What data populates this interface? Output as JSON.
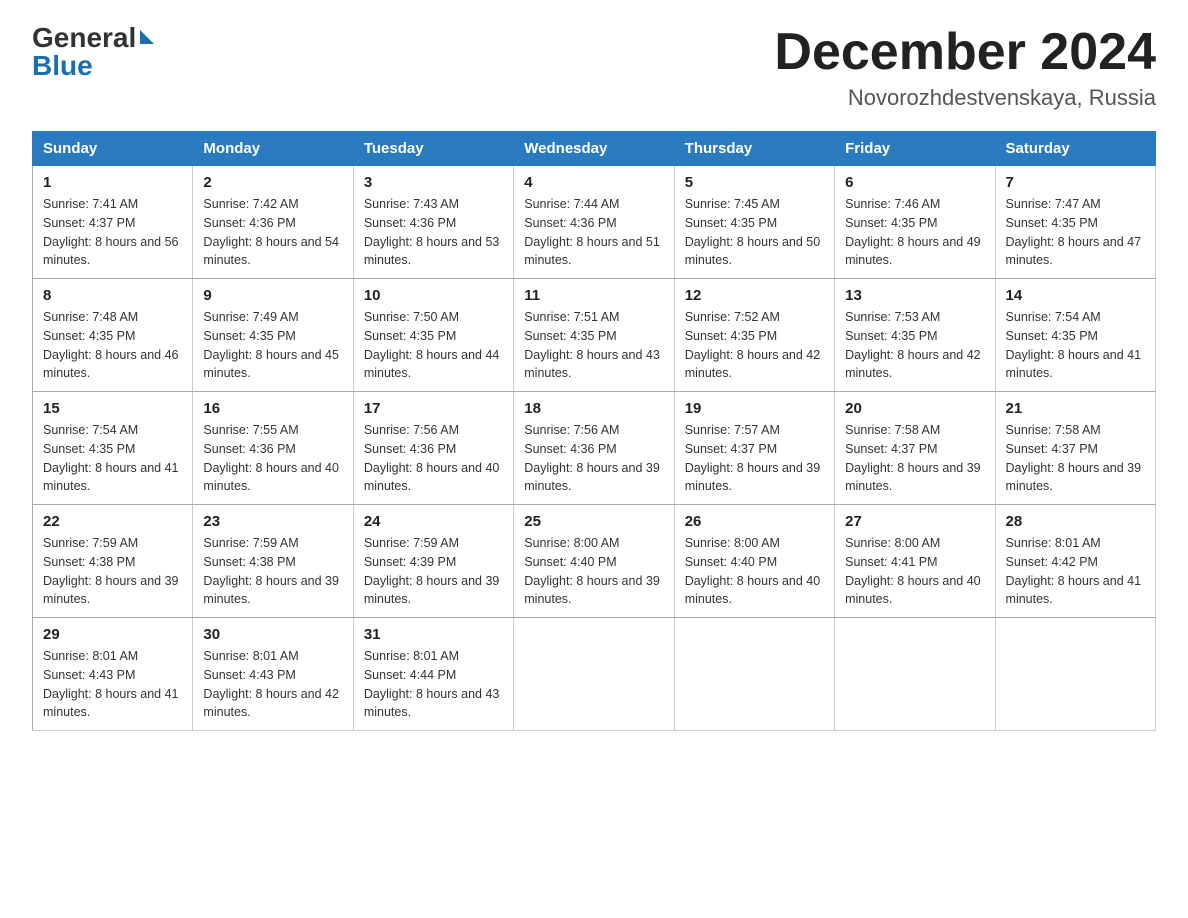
{
  "logo": {
    "general": "General",
    "blue": "Blue"
  },
  "title": "December 2024",
  "location": "Novorozhdestvenskaya, Russia",
  "days_of_week": [
    "Sunday",
    "Monday",
    "Tuesday",
    "Wednesday",
    "Thursday",
    "Friday",
    "Saturday"
  ],
  "weeks": [
    [
      {
        "day": "1",
        "sunrise": "7:41 AM",
        "sunset": "4:37 PM",
        "daylight": "8 hours and 56 minutes."
      },
      {
        "day": "2",
        "sunrise": "7:42 AM",
        "sunset": "4:36 PM",
        "daylight": "8 hours and 54 minutes."
      },
      {
        "day": "3",
        "sunrise": "7:43 AM",
        "sunset": "4:36 PM",
        "daylight": "8 hours and 53 minutes."
      },
      {
        "day": "4",
        "sunrise": "7:44 AM",
        "sunset": "4:36 PM",
        "daylight": "8 hours and 51 minutes."
      },
      {
        "day": "5",
        "sunrise": "7:45 AM",
        "sunset": "4:35 PM",
        "daylight": "8 hours and 50 minutes."
      },
      {
        "day": "6",
        "sunrise": "7:46 AM",
        "sunset": "4:35 PM",
        "daylight": "8 hours and 49 minutes."
      },
      {
        "day": "7",
        "sunrise": "7:47 AM",
        "sunset": "4:35 PM",
        "daylight": "8 hours and 47 minutes."
      }
    ],
    [
      {
        "day": "8",
        "sunrise": "7:48 AM",
        "sunset": "4:35 PM",
        "daylight": "8 hours and 46 minutes."
      },
      {
        "day": "9",
        "sunrise": "7:49 AM",
        "sunset": "4:35 PM",
        "daylight": "8 hours and 45 minutes."
      },
      {
        "day": "10",
        "sunrise": "7:50 AM",
        "sunset": "4:35 PM",
        "daylight": "8 hours and 44 minutes."
      },
      {
        "day": "11",
        "sunrise": "7:51 AM",
        "sunset": "4:35 PM",
        "daylight": "8 hours and 43 minutes."
      },
      {
        "day": "12",
        "sunrise": "7:52 AM",
        "sunset": "4:35 PM",
        "daylight": "8 hours and 42 minutes."
      },
      {
        "day": "13",
        "sunrise": "7:53 AM",
        "sunset": "4:35 PM",
        "daylight": "8 hours and 42 minutes."
      },
      {
        "day": "14",
        "sunrise": "7:54 AM",
        "sunset": "4:35 PM",
        "daylight": "8 hours and 41 minutes."
      }
    ],
    [
      {
        "day": "15",
        "sunrise": "7:54 AM",
        "sunset": "4:35 PM",
        "daylight": "8 hours and 41 minutes."
      },
      {
        "day": "16",
        "sunrise": "7:55 AM",
        "sunset": "4:36 PM",
        "daylight": "8 hours and 40 minutes."
      },
      {
        "day": "17",
        "sunrise": "7:56 AM",
        "sunset": "4:36 PM",
        "daylight": "8 hours and 40 minutes."
      },
      {
        "day": "18",
        "sunrise": "7:56 AM",
        "sunset": "4:36 PM",
        "daylight": "8 hours and 39 minutes."
      },
      {
        "day": "19",
        "sunrise": "7:57 AM",
        "sunset": "4:37 PM",
        "daylight": "8 hours and 39 minutes."
      },
      {
        "day": "20",
        "sunrise": "7:58 AM",
        "sunset": "4:37 PM",
        "daylight": "8 hours and 39 minutes."
      },
      {
        "day": "21",
        "sunrise": "7:58 AM",
        "sunset": "4:37 PM",
        "daylight": "8 hours and 39 minutes."
      }
    ],
    [
      {
        "day": "22",
        "sunrise": "7:59 AM",
        "sunset": "4:38 PM",
        "daylight": "8 hours and 39 minutes."
      },
      {
        "day": "23",
        "sunrise": "7:59 AM",
        "sunset": "4:38 PM",
        "daylight": "8 hours and 39 minutes."
      },
      {
        "day": "24",
        "sunrise": "7:59 AM",
        "sunset": "4:39 PM",
        "daylight": "8 hours and 39 minutes."
      },
      {
        "day": "25",
        "sunrise": "8:00 AM",
        "sunset": "4:40 PM",
        "daylight": "8 hours and 39 minutes."
      },
      {
        "day": "26",
        "sunrise": "8:00 AM",
        "sunset": "4:40 PM",
        "daylight": "8 hours and 40 minutes."
      },
      {
        "day": "27",
        "sunrise": "8:00 AM",
        "sunset": "4:41 PM",
        "daylight": "8 hours and 40 minutes."
      },
      {
        "day": "28",
        "sunrise": "8:01 AM",
        "sunset": "4:42 PM",
        "daylight": "8 hours and 41 minutes."
      }
    ],
    [
      {
        "day": "29",
        "sunrise": "8:01 AM",
        "sunset": "4:43 PM",
        "daylight": "8 hours and 41 minutes."
      },
      {
        "day": "30",
        "sunrise": "8:01 AM",
        "sunset": "4:43 PM",
        "daylight": "8 hours and 42 minutes."
      },
      {
        "day": "31",
        "sunrise": "8:01 AM",
        "sunset": "4:44 PM",
        "daylight": "8 hours and 43 minutes."
      },
      null,
      null,
      null,
      null
    ]
  ]
}
